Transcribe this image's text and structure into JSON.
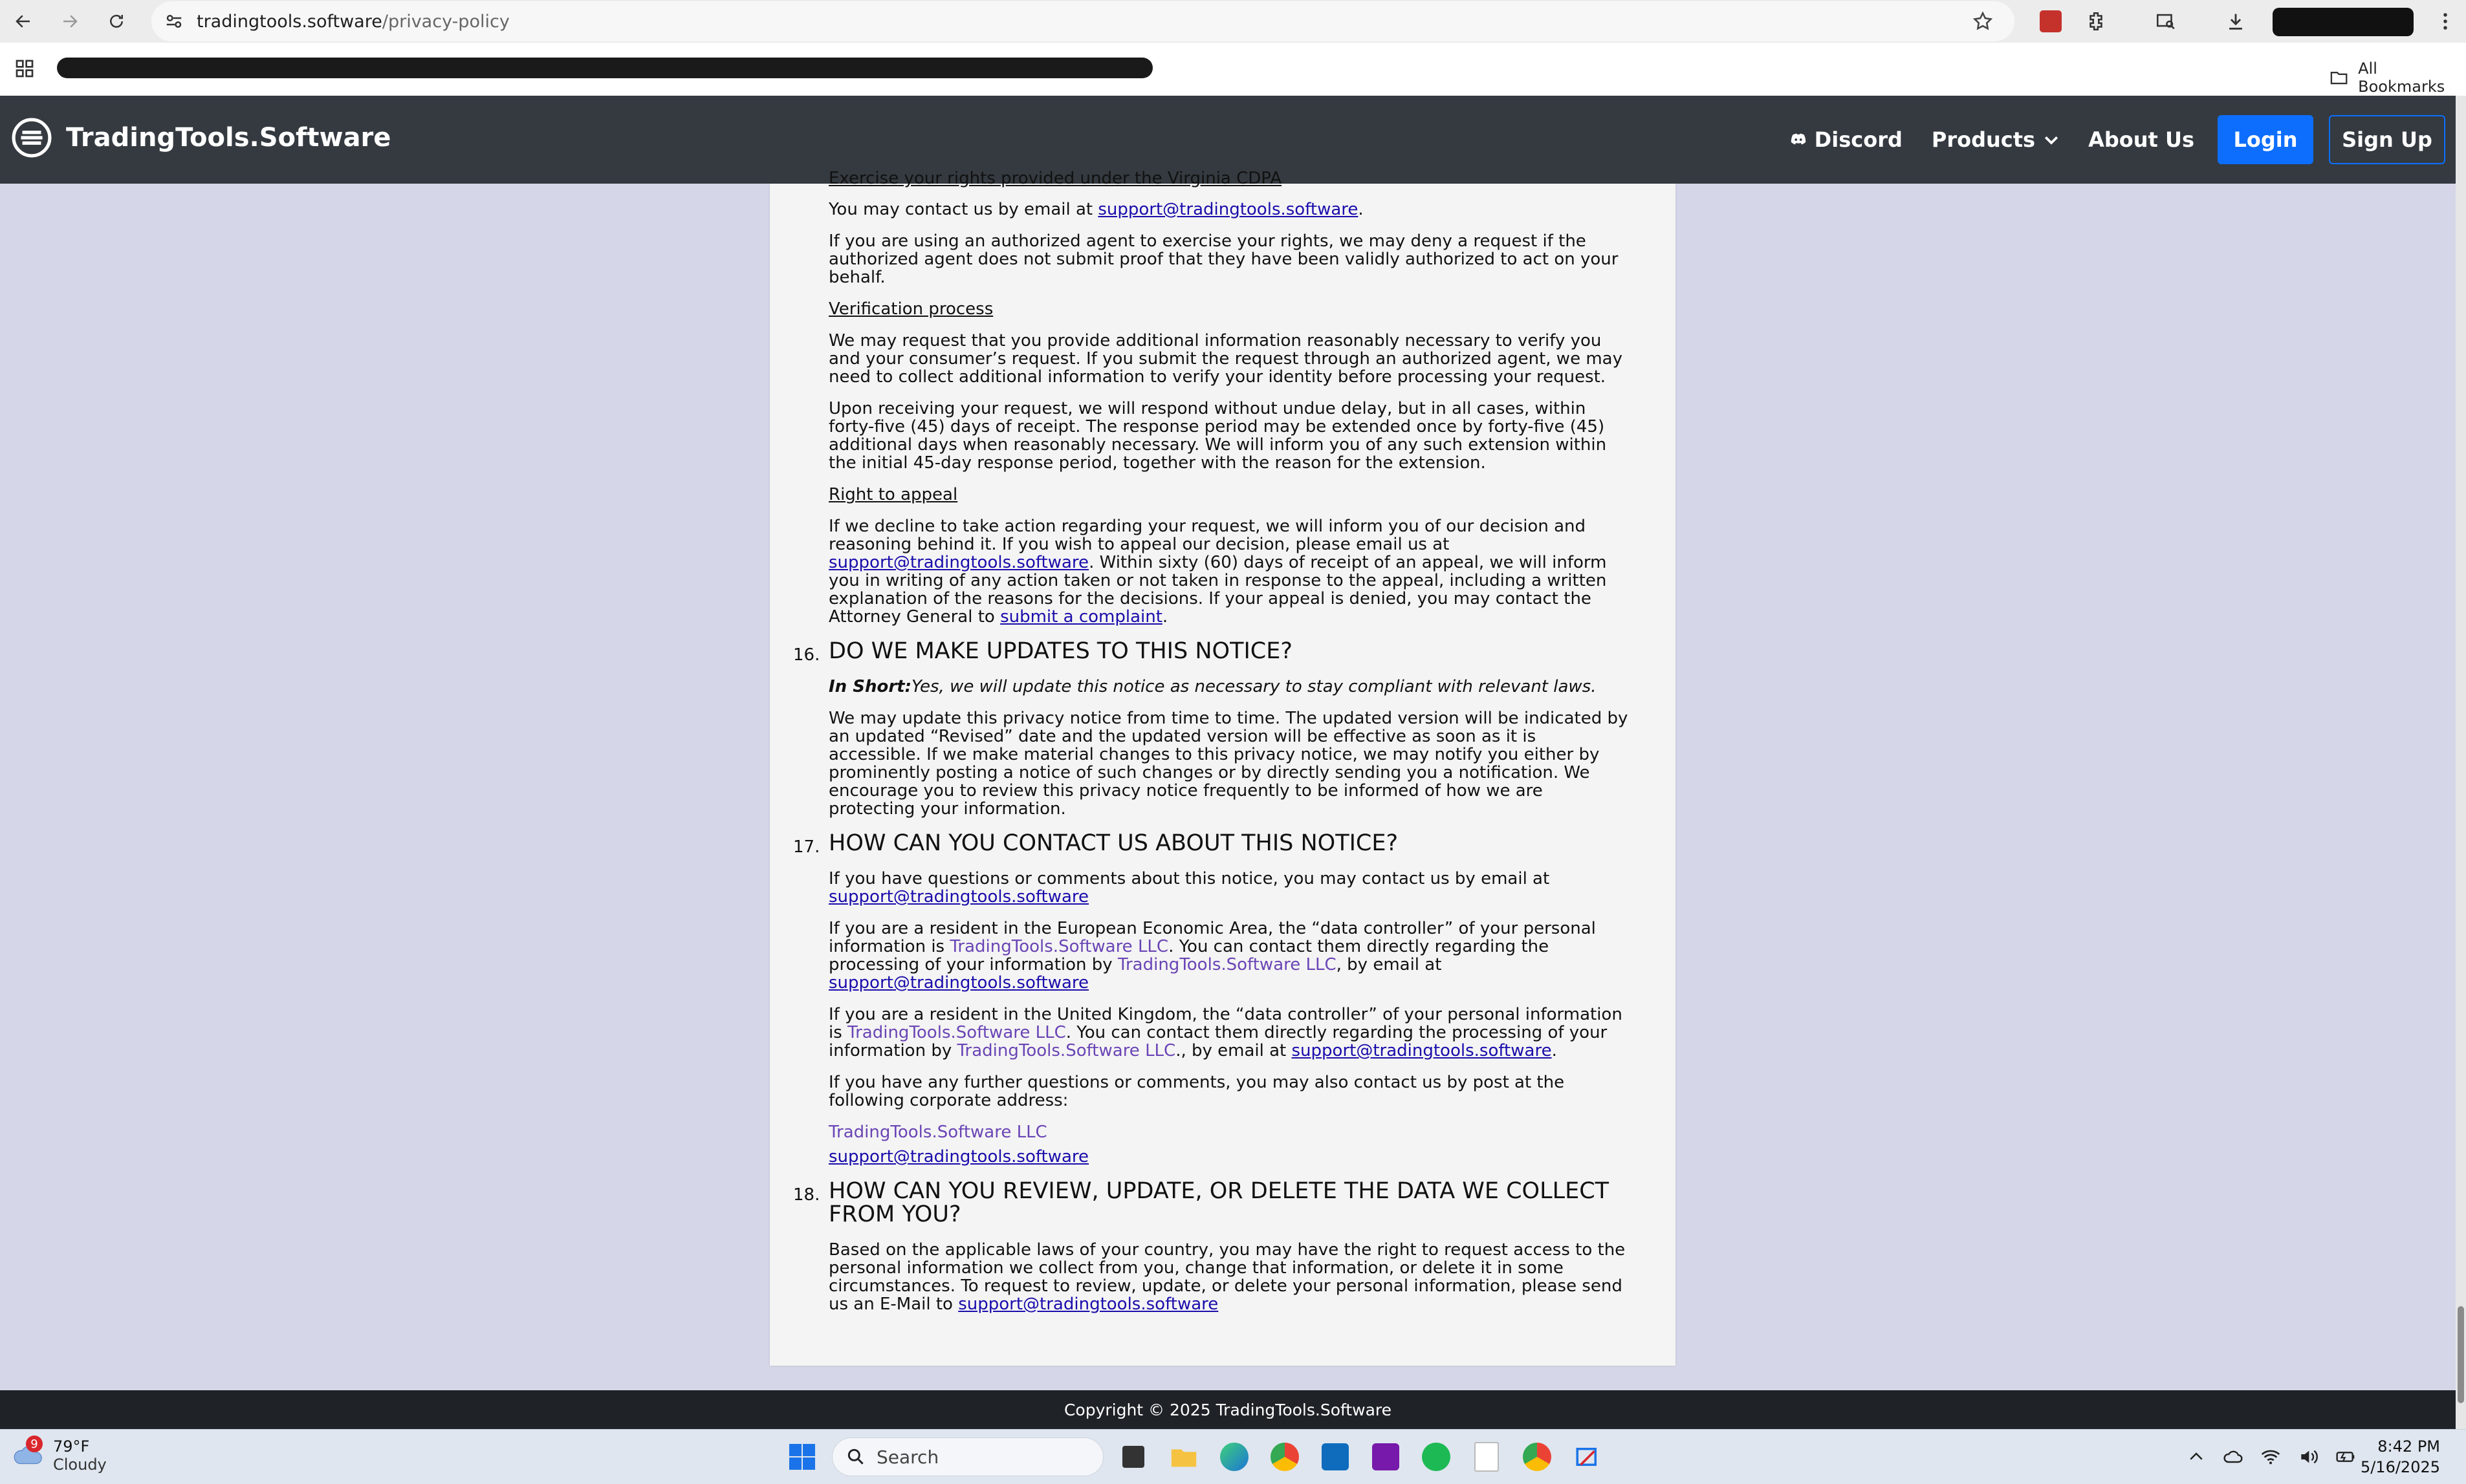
{
  "browser": {
    "url_host": "tradingtools.software",
    "url_path": "/privacy-policy",
    "bookmarks_label": "All Bookmarks"
  },
  "header": {
    "brand": "TradingTools.Software",
    "nav": {
      "discord": "Discord",
      "products": "Products",
      "about": "About Us",
      "login": "Login",
      "signup": "Sign Up"
    },
    "colors": {
      "bar": "#343a40",
      "login": "#0d6efd"
    }
  },
  "policy": {
    "top_heading": "Exercise your rights provided under the Virginia CDPA",
    "contact_email_pre": "You may contact us by email at ",
    "email": "support@tradingtools.software",
    "authorized_agent": "If you are using an authorized agent to exercise your rights, we may deny a request if the authorized agent does not submit proof that they have been validly authorized to act on your behalf.",
    "verification_heading": "Verification process",
    "verification_p1": "We may request that you provide additional information reasonably necessary to verify you and your consumer’s request. If you submit the request through an authorized agent, we may need to collect additional information to verify your identity before processing your request.",
    "verification_p2": "Upon receiving your request, we will respond without undue delay, but in all cases, within forty-five (45) days of receipt. The response period may be extended once by forty-five (45) additional days when reasonably necessary. We will inform you of any such extension within the initial 45-day response period, together with the reason for the extension.",
    "appeal_heading": "Right to appeal",
    "appeal_pre": "If we decline to take action regarding your request, we will inform you of our decision and reasoning behind it. If you wish to appeal our decision, please email us at ",
    "appeal_mid": ". Within sixty (60) days of receipt of an appeal, we will inform you in writing of any action taken or not taken in response to the appeal, including a written explanation of the reasons for the decisions. If your appeal is denied, you may contact the Attorney General to ",
    "appeal_link": "submit a complaint",
    "s16_num": "16.",
    "s16_title": "DO WE MAKE UPDATES TO THIS NOTICE?",
    "s16_short_label": "In Short:",
    "s16_short_text": "Yes, we will update this notice as necessary to stay compliant with relevant laws.",
    "s16_body": "We may update this privacy notice from time to time. The updated version will be indicated by an updated “Revised” date and the updated version will be effective as soon as it is accessible. If we make material changes to this privacy notice, we may notify you either by prominently posting a notice of such changes or by directly sending you a notification. We encourage you to review this privacy notice frequently to be informed of how we are protecting your information.",
    "s17_num": "17.",
    "s17_title": "HOW CAN YOU CONTACT US ABOUT THIS NOTICE?",
    "s17_p1": "If you have questions or comments about this notice, you may contact us by email at",
    "eea_a": "If you are a resident in the European Economic Area, the “data controller” of your personal information is ",
    "company": "TradingTools.Software LLC",
    "eea_b": ". You can contact them directly regarding the processing of your information by ",
    "eea_c": ", by email at ",
    "uk_a": "If you are a resident in the United Kingdom, the “data controller” of your personal information is ",
    "uk_b": ". You can contact them directly regarding the processing of your information by ",
    "uk_c": "., by email at ",
    "postal_p": "If you have any further questions or comments, you may also contact us by post at the following corporate address:",
    "s18_num": "18.",
    "s18_title": "HOW CAN YOU REVIEW, UPDATE, OR DELETE THE DATA WE COLLECT FROM YOU?",
    "s18_body": "Based on the applicable laws of your country, you may have the right to request access to the personal information we collect from you, change that information, or delete it in some circumstances. To request to review, update, or delete your personal information, please send us an E-Mail to "
  },
  "footer": {
    "copyright": "Copyright © 2025 TradingTools.Software"
  },
  "taskbar": {
    "weather_badge": "9",
    "weather_temp": "79°F",
    "weather_cond": "Cloudy",
    "search_label": "Search",
    "time": "8:42 PM",
    "date": "5/16/2025"
  }
}
